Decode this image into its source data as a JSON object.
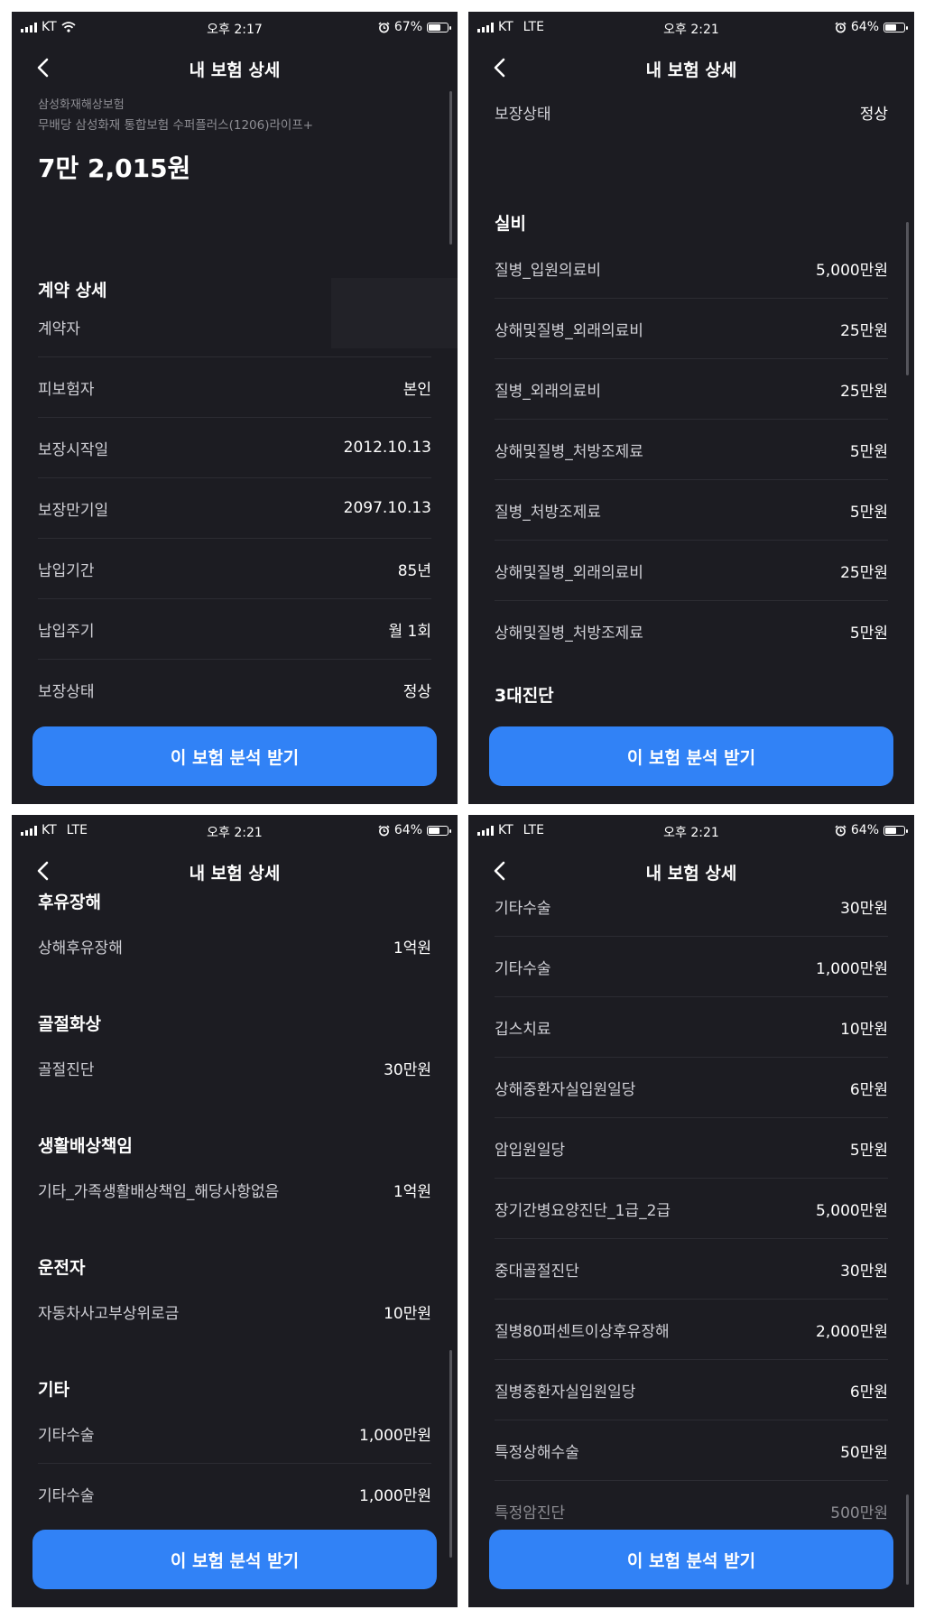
{
  "screens": [
    {
      "status": {
        "carrier": "KT",
        "network": "",
        "time": "오후 2:17",
        "battery": "67%",
        "battery_level": 0.67
      },
      "nav": {
        "title": "내 보험 상세"
      },
      "header": {
        "company": "삼성화재해상보험",
        "product": "무배당 삼성화재 통합보험 수퍼플러스(1206)라이프+",
        "amount": "7만 2,015원"
      },
      "sections": [
        {
          "title": "계약 상세",
          "rows": [
            {
              "label": "계약자",
              "value": ""
            },
            {
              "label": "피보험자",
              "value": "본인"
            },
            {
              "label": "보장시작일",
              "value": "2012.10.13"
            },
            {
              "label": "보장만기일",
              "value": "2097.10.13"
            },
            {
              "label": "납입기간",
              "value": "85년"
            },
            {
              "label": "납입주기",
              "value": "월 1회"
            },
            {
              "label": "보장상태",
              "value": "정상"
            }
          ]
        }
      ],
      "cta": "이 보험 분석 받기"
    },
    {
      "status": {
        "carrier": "KT",
        "network": "LTE",
        "time": "오후 2:21",
        "battery": "64%",
        "battery_level": 0.64
      },
      "nav": {
        "title": "내 보험 상세"
      },
      "sections": [
        {
          "title": "",
          "rows": [
            {
              "label": "보장상태",
              "value": "정상"
            }
          ]
        },
        {
          "title": "실비",
          "rows": [
            {
              "label": "질병_입원의료비",
              "value": "5,000만원"
            },
            {
              "label": "상해및질병_외래의료비",
              "value": "25만원"
            },
            {
              "label": "질병_외래의료비",
              "value": "25만원"
            },
            {
              "label": "상해및질병_처방조제료",
              "value": "5만원"
            },
            {
              "label": "질병_처방조제료",
              "value": "5만원"
            },
            {
              "label": "상해및질병_외래의료비",
              "value": "25만원"
            },
            {
              "label": "상해및질병_처방조제료",
              "value": "5만원"
            }
          ]
        },
        {
          "title": "3대진단",
          "rows": []
        }
      ],
      "cta": "이 보험 분석 받기"
    },
    {
      "status": {
        "carrier": "KT",
        "network": "LTE",
        "time": "오후 2:21",
        "battery": "64%",
        "battery_level": 0.64
      },
      "nav": {
        "title": "내 보험 상세"
      },
      "sections": [
        {
          "title": "후유장해",
          "rows": [
            {
              "label": "상해후유장해",
              "value": "1억원"
            }
          ]
        },
        {
          "title": "골절화상",
          "rows": [
            {
              "label": "골절진단",
              "value": "30만원"
            }
          ]
        },
        {
          "title": "생활배상책임",
          "rows": [
            {
              "label": "기타_가족생활배상책임_해당사항없음",
              "value": "1억원"
            }
          ]
        },
        {
          "title": "운전자",
          "rows": [
            {
              "label": "자동차사고부상위로금",
              "value": "10만원"
            }
          ]
        },
        {
          "title": "기타",
          "rows": [
            {
              "label": "기타수술",
              "value": "1,000만원"
            },
            {
              "label": "기타수술",
              "value": "1,000만원"
            }
          ]
        }
      ],
      "cta": "이 보험 분석 받기"
    },
    {
      "status": {
        "carrier": "KT",
        "network": "LTE",
        "time": "오후 2:21",
        "battery": "64%",
        "battery_level": 0.64
      },
      "nav": {
        "title": "내 보험 상세"
      },
      "sections": [
        {
          "title": "",
          "rows": [
            {
              "label": "기타수술",
              "value": "30만원"
            },
            {
              "label": "기타수술",
              "value": "1,000만원"
            },
            {
              "label": "깁스치료",
              "value": "10만원"
            },
            {
              "label": "상해중환자실입원일당",
              "value": "6만원"
            },
            {
              "label": "암입원일당",
              "value": "5만원"
            },
            {
              "label": "장기간병요양진단_1급_2급",
              "value": "5,000만원"
            },
            {
              "label": "중대골절진단",
              "value": "30만원"
            },
            {
              "label": "질병80퍼센트이상후유장해",
              "value": "2,000만원"
            },
            {
              "label": "질병중환자실입원일당",
              "value": "6만원"
            },
            {
              "label": "특정상해수술",
              "value": "50만원"
            },
            {
              "label": "특정암진단",
              "value": "500만원"
            }
          ]
        }
      ],
      "cta": "이 보험 분석 받기"
    }
  ]
}
